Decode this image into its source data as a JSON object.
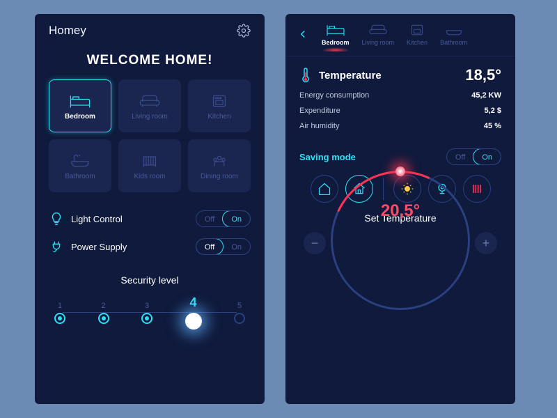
{
  "app_title": "Homey",
  "welcome": "Welcome Home!",
  "rooms": [
    {
      "label": "Bedroom",
      "active": true
    },
    {
      "label": "Living room",
      "active": false
    },
    {
      "label": "Kitchen",
      "active": false
    },
    {
      "label": "Bathroom",
      "active": false
    },
    {
      "label": "Kids room",
      "active": false
    },
    {
      "label": "Dining room",
      "active": false
    }
  ],
  "controls": {
    "light": {
      "label": "Light Control",
      "off": "Off",
      "on": "On",
      "state": "on"
    },
    "power": {
      "label": "Power Supply",
      "off": "Off",
      "on": "On",
      "state": "off"
    }
  },
  "security": {
    "title": "Security level",
    "levels": [
      "1",
      "2",
      "3",
      "4",
      "5"
    ],
    "selected": 4
  },
  "tabs": [
    {
      "label": "Bedroom",
      "active": true
    },
    {
      "label": "Living room",
      "active": false
    },
    {
      "label": "Kitchen",
      "active": false
    },
    {
      "label": "Bathroom",
      "active": false
    }
  ],
  "temperature": {
    "title": "Temperature",
    "value": "18,5°",
    "stats": [
      {
        "label": "Energy consumption",
        "value": "45,2 KW"
      },
      {
        "label": "Expenditure",
        "value": "5,2 $"
      },
      {
        "label": "Air humidity",
        "value": "45 %"
      }
    ]
  },
  "saving": {
    "label": "Saving mode",
    "off": "Off",
    "on": "On",
    "state": "on"
  },
  "set_temp": {
    "title": "Set Temperature",
    "value": "20,5°"
  }
}
